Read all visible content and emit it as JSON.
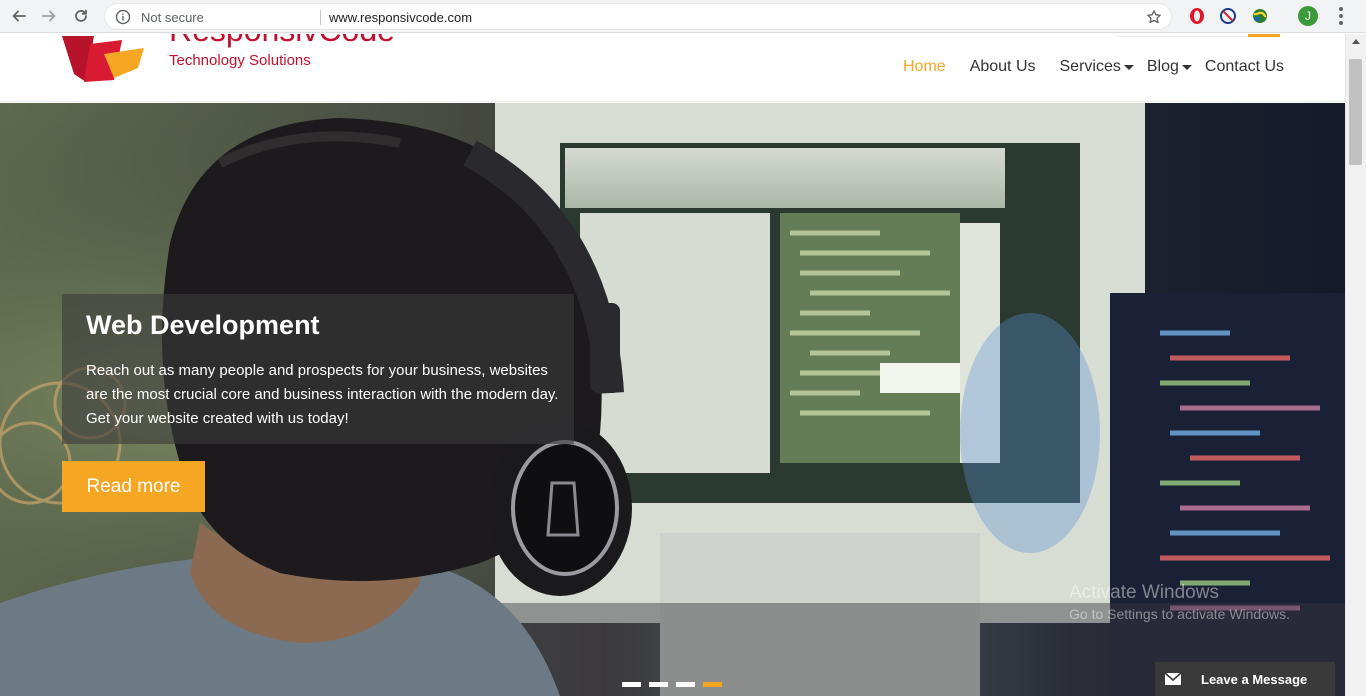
{
  "browser": {
    "security_label": "Not secure",
    "url": "www.responsivcode.com",
    "profile_initial": "J"
  },
  "site": {
    "brand_name": "ResponsivCode",
    "tagline": "Technology Solutions",
    "brand_color": "#c4102e",
    "accent_color": "#f5a623"
  },
  "nav": {
    "home": "Home",
    "about": "About Us",
    "services": "Services",
    "blog": "Blog",
    "contact": "Contact Us"
  },
  "hero": {
    "title": "Web Development",
    "description": "Reach out as many people and prospects for your business, websites are the most crucial core and business interaction with the modern day. Get your website created with us today!",
    "cta": "Read more",
    "slide_count": 4,
    "active_slide": 4
  },
  "watermark": {
    "title": "Activate Windows",
    "subtitle": "Go to Settings to activate Windows."
  },
  "chat": {
    "label": "Leave a Message"
  },
  "icons": {
    "back": "back-arrow-icon",
    "forward": "forward-arrow-icon",
    "reload": "reload-icon",
    "info": "info-icon",
    "star": "star-icon",
    "opera": "opera-icon",
    "block": "block-icon",
    "globe": "globe-extension-icon",
    "menu": "more-vert-icon",
    "mail": "mail-icon"
  }
}
